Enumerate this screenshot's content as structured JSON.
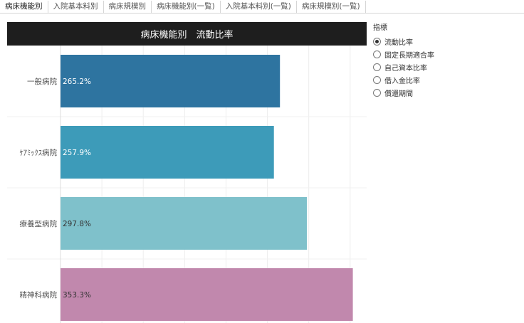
{
  "tabs": [
    {
      "label": "病床機能別",
      "active": true
    },
    {
      "label": "入院基本料別",
      "active": false
    },
    {
      "label": "病床規模別",
      "active": false
    },
    {
      "label": "病床機能別(一覧)",
      "active": false
    },
    {
      "label": "入院基本料別(一覧)",
      "active": false
    },
    {
      "label": "病床規模別(一覧)",
      "active": false
    }
  ],
  "chart_title": "病床機能別　流動比率",
  "legend": {
    "title": "指標",
    "options": [
      {
        "label": "流動比率",
        "selected": true
      },
      {
        "label": "固定長期適合率",
        "selected": false
      },
      {
        "label": "自己資本比率",
        "selected": false
      },
      {
        "label": "借入金比率",
        "selected": false
      },
      {
        "label": "償還期間",
        "selected": false
      }
    ]
  },
  "chart_data": {
    "type": "bar",
    "orientation": "horizontal",
    "title": "病床機能別　流動比率",
    "categories": [
      "一般病院",
      "ｹｱﾐｯｸｽ病院",
      "療養型病院",
      "精神科病院"
    ],
    "values": [
      265.2,
      257.9,
      297.8,
      353.3
    ],
    "labels": [
      "265.2%",
      "257.9%",
      "297.8%",
      "353.3%"
    ],
    "colors": [
      "#2e74a0",
      "#3d9bb9",
      "#7fc1cb",
      "#c188ad"
    ],
    "label_colors": [
      "#ffffff",
      "#ffffff",
      "#333333",
      "#333333"
    ],
    "xlim": [
      0,
      370
    ],
    "grid": true
  }
}
